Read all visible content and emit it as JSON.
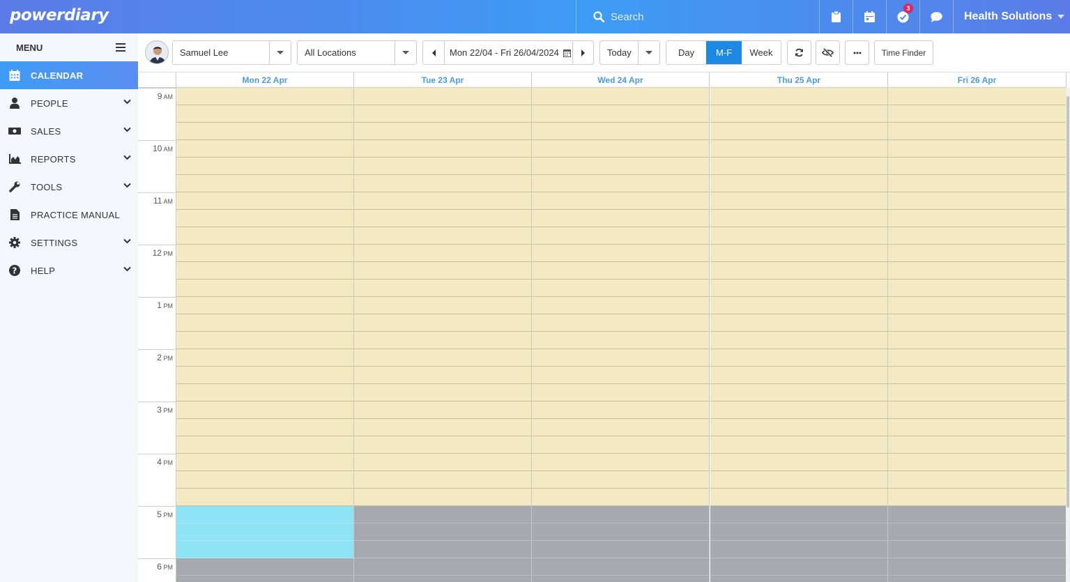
{
  "header": {
    "logo": "powerdiary",
    "search_placeholder": "Search",
    "notifications_count": "3",
    "org_name": "Health Solutions"
  },
  "sidebar": {
    "menu_label": "MENU",
    "items": [
      {
        "label": "CALENDAR",
        "icon": "calendar-icon"
      },
      {
        "label": "PEOPLE",
        "icon": "person-icon"
      },
      {
        "label": "SALES",
        "icon": "money-icon"
      },
      {
        "label": "REPORTS",
        "icon": "chart-icon"
      },
      {
        "label": "TOOLS",
        "icon": "wrench-icon"
      },
      {
        "label": "PRACTICE MANUAL",
        "icon": "document-icon"
      },
      {
        "label": "SETTINGS",
        "icon": "gear-icon"
      },
      {
        "label": "HELP",
        "icon": "help-icon"
      }
    ]
  },
  "toolbar": {
    "practitioner": "Samuel Lee",
    "location": "All Locations",
    "date_range": "Mon 22/04 - Fri 26/04/2024",
    "today_label": "Today",
    "views": [
      "Day",
      "M-F",
      "Week"
    ],
    "active_view": "M-F",
    "time_finder_label": "Time Finder"
  },
  "calendar": {
    "days": [
      "Mon 22 Apr",
      "Tue 23 Apr",
      "Wed 24 Apr",
      "Thu 25 Apr",
      "Fri 26 Apr"
    ],
    "hours": [
      {
        "num": "9",
        "ampm": "AM"
      },
      {
        "num": "10",
        "ampm": "AM"
      },
      {
        "num": "11",
        "ampm": "AM"
      },
      {
        "num": "12",
        "ampm": "PM"
      },
      {
        "num": "1",
        "ampm": "PM"
      },
      {
        "num": "2",
        "ampm": "PM"
      },
      {
        "num": "3",
        "ampm": "PM"
      },
      {
        "num": "4",
        "ampm": "PM"
      },
      {
        "num": "5",
        "ampm": "PM"
      },
      {
        "num": "6",
        "ampm": "PM"
      }
    ],
    "slots_per_hour": 3,
    "colors": {
      "available": "#f3e9c3",
      "unavailable": "#a6a9ae",
      "selected": "#8ee4f5"
    }
  }
}
